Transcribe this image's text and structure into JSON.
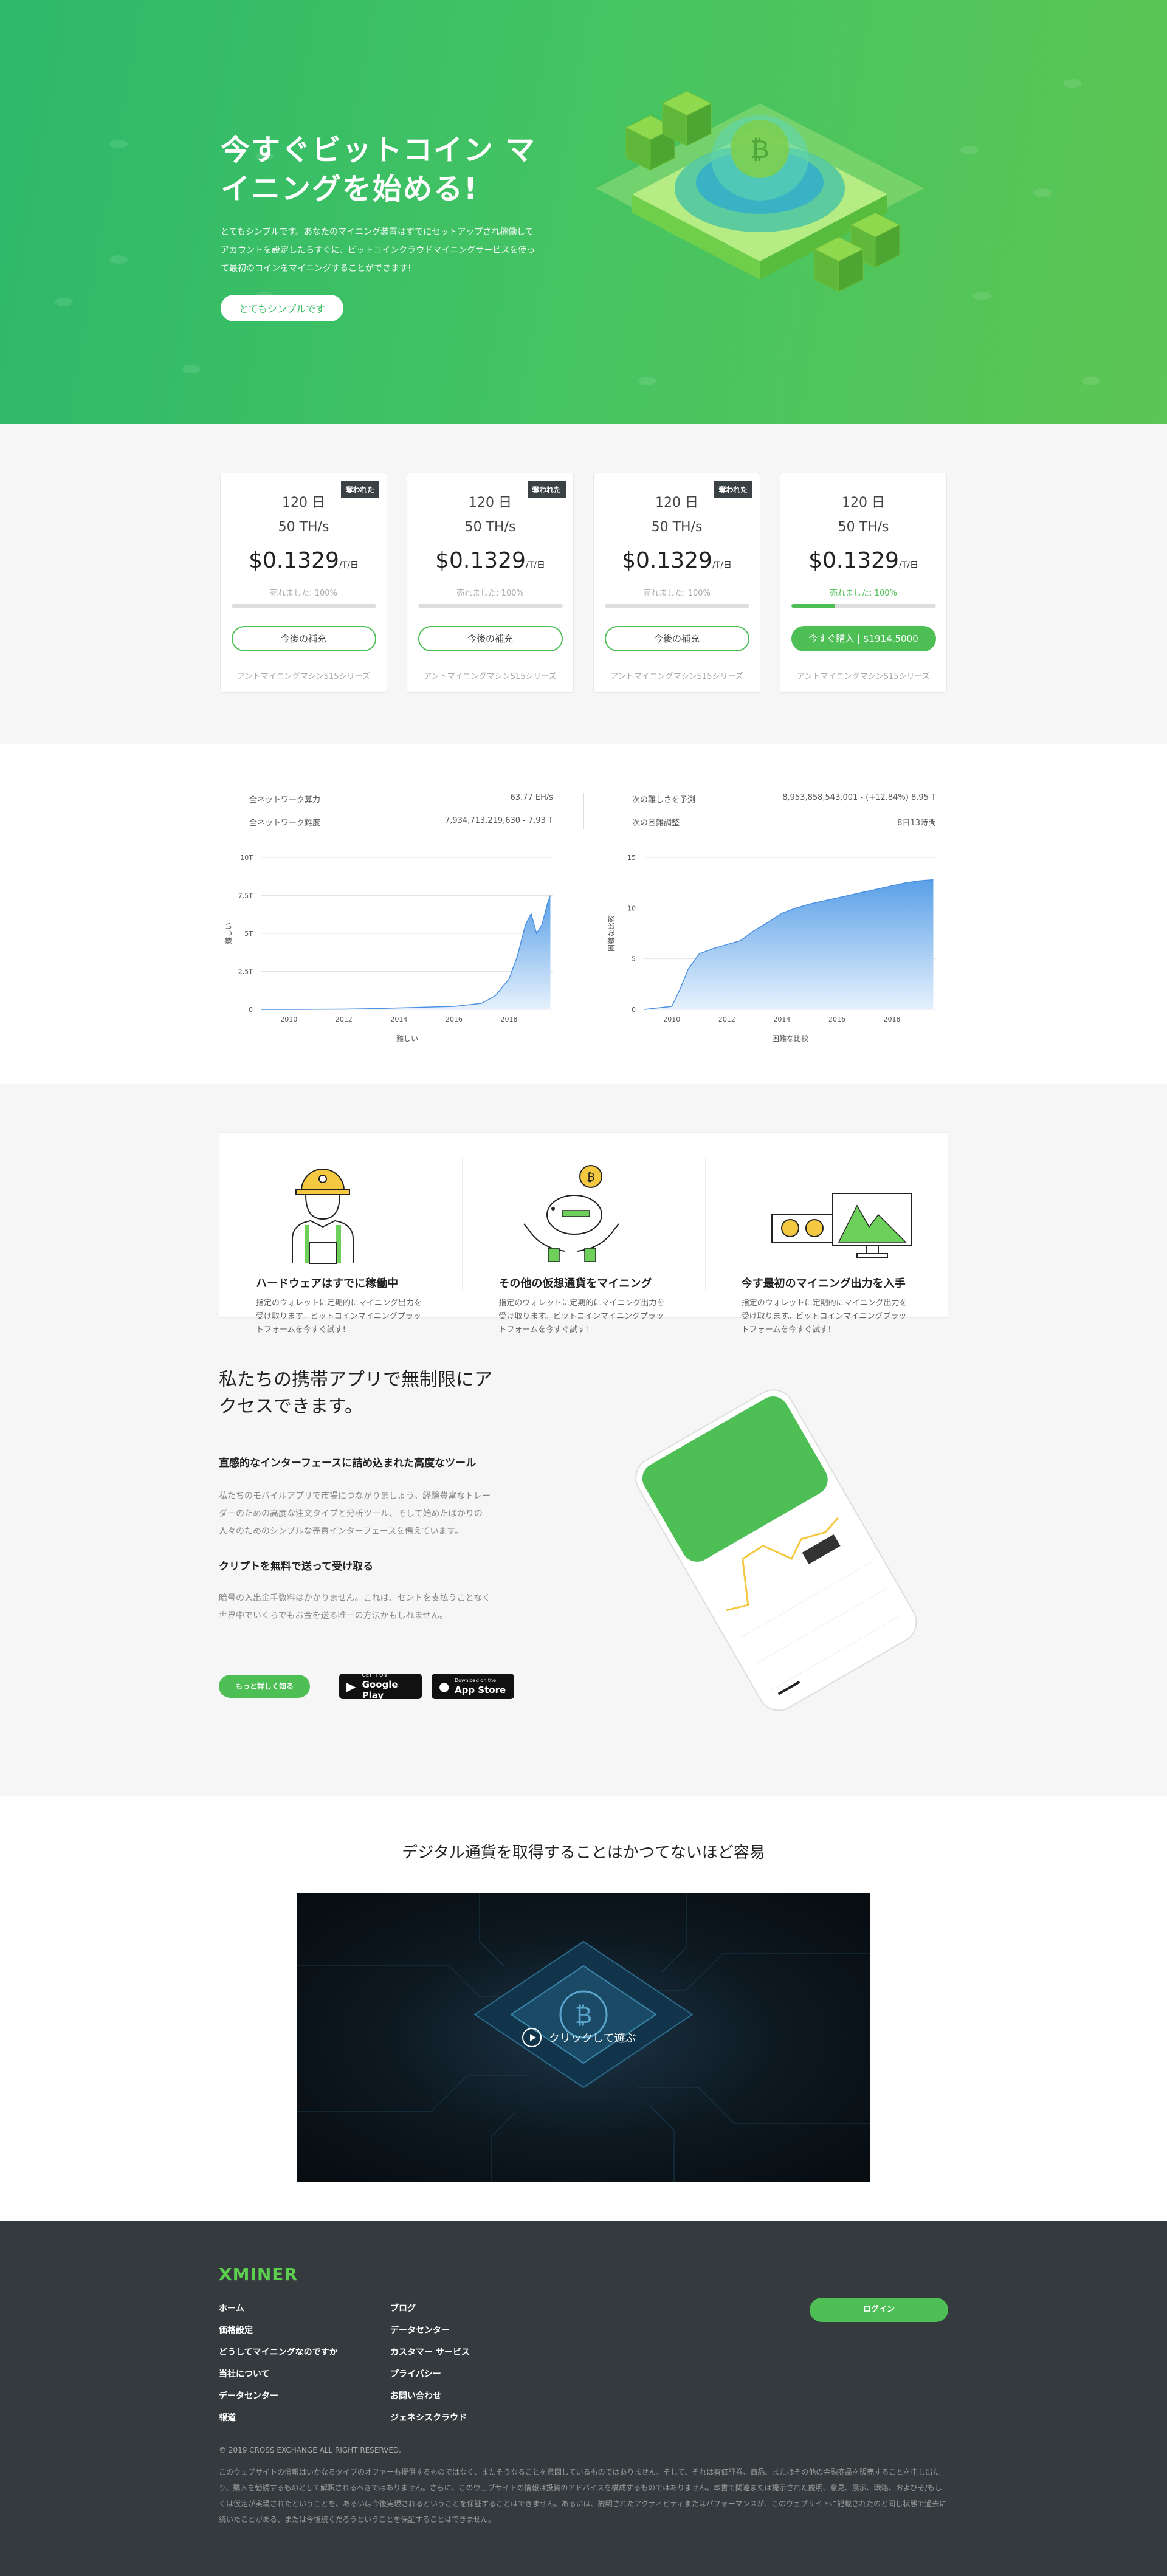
{
  "hero": {
    "title": "今すぐビットコイン マ\nイニングを始める!",
    "description": "とてもシンプルです。あなたのマイニング装置はすでにセットアップされ稼働して\nアカウントを設定したらすぐに、ビットコインクラウドマイニングサービスを使っ\nて最初のコインをマイニングすることができます!",
    "button": "とてもシンプルです"
  },
  "pricing": {
    "cards": [
      {
        "badge": "奪われた",
        "days": "120 日",
        "hash": "50 TH/s",
        "price": "$0.1329",
        "unit": "/T/日",
        "sold": "売れました: 100%",
        "progress": 1.0,
        "button": "今後の補充",
        "sub": "アントマイニングマシンS15シリーズ"
      },
      {
        "badge": "奪われた",
        "days": "120 日",
        "hash": "50 TH/s",
        "price": "$0.1329",
        "unit": "/T/日",
        "sold": "売れました: 100%",
        "progress": 1.0,
        "button": "今後の補充",
        "sub": "アントマイニングマシンS15シリーズ"
      },
      {
        "badge": "奪われた",
        "days": "120 日",
        "hash": "50 TH/s",
        "price": "$0.1329",
        "unit": "/T/日",
        "sold": "売れました: 100%",
        "progress": 1.0,
        "button": "今後の補充",
        "sub": "アントマイニングマシンS15シリーズ"
      },
      {
        "badge": "",
        "days": "120 日",
        "hash": "50 TH/s",
        "price": "$0.1329",
        "unit": "/T/日",
        "sold": "売れました: 100%",
        "progress": 0.3,
        "button": "今すぐ購入 | $1914.5000",
        "sub": "アントマイニングマシンS15シリーズ"
      }
    ]
  },
  "stats": {
    "left": {
      "rows": [
        {
          "label": "全ネットワーク算力",
          "value": "63.77 EH/s"
        },
        {
          "label": "全ネットワーク難度",
          "value": "7,934,713,219,630 - 7.93 T"
        }
      ]
    },
    "right": {
      "rows": [
        {
          "label": "次の難しさを予測",
          "value": "8,953,858,543,001 - (+12.84%) 8.95 T"
        },
        {
          "label": "次の困難調整",
          "value": "8日13時間"
        }
      ]
    }
  },
  "chart_data": [
    {
      "type": "area",
      "xlabel": "難しい",
      "ylabel": "難しい",
      "x": [
        2009,
        2010,
        2011,
        2012,
        2013,
        2014,
        2015,
        2016,
        2017,
        2017.5,
        2018,
        2018.3,
        2018.6,
        2018.8,
        2019,
        2019.2,
        2019.4,
        2019.5
      ],
      "y": [
        0,
        0,
        0.01,
        0.02,
        0.05,
        0.1,
        0.15,
        0.2,
        0.4,
        0.9,
        2.0,
        3.5,
        5.6,
        6.3,
        5.0,
        5.6,
        7.0,
        7.5
      ],
      "xticks": [
        "2010",
        "2012",
        "2014",
        "2016",
        "2018"
      ],
      "yticks": [
        "0",
        "2.5T",
        "5T",
        "7.5T",
        "10T"
      ],
      "ylim": [
        0,
        10
      ]
    },
    {
      "type": "area",
      "xlabel": "困難な比較",
      "ylabel": "困難な比較",
      "x": [
        2009,
        2010,
        2010.3,
        2010.6,
        2011,
        2011.5,
        2012,
        2012.5,
        2013,
        2013.5,
        2014,
        2014.5,
        2015,
        2015.5,
        2016,
        2016.5,
        2017,
        2017.5,
        2018,
        2018.5,
        2019,
        2019.5
      ],
      "y": [
        0,
        0.3,
        2.0,
        4.0,
        5.5,
        6.0,
        6.4,
        6.8,
        7.8,
        8.6,
        9.5,
        10.0,
        10.4,
        10.7,
        11.0,
        11.3,
        11.6,
        11.9,
        12.2,
        12.5,
        12.7,
        12.8
      ],
      "xticks": [
        "2010",
        "2012",
        "2014",
        "2016",
        "2018"
      ],
      "yticks": [
        "0",
        "5",
        "10",
        "15"
      ],
      "ylim": [
        0,
        15
      ]
    }
  ],
  "features": [
    {
      "title": "ハードウェアはすでに稼働中",
      "text": "指定のウォレットに定期的にマイニング出力を受け取ります。ビットコインマイニングプラットフォームを今すぐ試す!"
    },
    {
      "title": "その他の仮想通貨をマイニング",
      "text": "指定のウォレットに定期的にマイニング出力を受け取ります。ビットコインマイニングプラットフォームを今すぐ試す!"
    },
    {
      "title": "今す最初のマイニング出力を入手",
      "text": "指定のウォレットに定期的にマイニング出力を受け取ります。ビットコインマイニングプラットフォームを今すぐ試す!"
    }
  ],
  "app": {
    "title": "私たちの携帯アプリで無制限にア\nクセスできます。",
    "h1": "直感的なインターフェースに詰め込まれた高度なツール",
    "p1": "私たちのモバイルアプリで市場につながりましょう。経験豊富なトレーダーのための高度な注文タイプと分析ツール、そして始めたばかりの人々のためのシンプルな売買インターフェースを備えています。",
    "h2": "クリプトを無料で送って受け取る",
    "p2": "暗号の入出金手数料はかかりません。これは、セントを支払うことなく世界中でいくらでもお金を送る唯一の方法かもしれません。",
    "more": "もっと詳しく知る",
    "google_top": "GET IT ON",
    "google": "Google Play",
    "apple_top": "Download on the",
    "apple": "App Store"
  },
  "video": {
    "title": "デジタル通貨を取得することはかつてないほど容易",
    "play": "クリックして遊ぶ"
  },
  "footer": {
    "logo": "XMINER",
    "col1": [
      "ホーム",
      "価格設定",
      "どうしてマイニングなのですか",
      "当社について",
      "データセンター",
      "報道"
    ],
    "col2": [
      "ブログ",
      "データセンター",
      "カスタマー サービス",
      "プライバシー",
      "お問い合わせ",
      "ジェネシスクラウド"
    ],
    "login": "ログイン",
    "copyright": "© 2019 CROSS EXCHANGE ALL RIGHT RESERVED.",
    "disclaimer": "このウェブサイトの情報はいかなるタイプのオファーも提供するものではなく、またそうなることを意図しているものではありません。そして、それは有価証券、商品、またはその他の金融商品を販売することを申し出たり、購入を勧誘するものとして解釈されるべきではありません。さらに、このウェブサイトの情報は投資のアドバイスを構成するものではありません。本書で関連または提示された説明、意見、展示、戦略、およびそ/もしくは仮定が実現されたということを、あるいは今後実現されるということを保証することはできません。あるいは、説明されたアクティビティまたはパフォーマンスが、このウェブサイトに記載されたのと同じ状態で過去に続いたことがある、または今後続くだろうということを保証することはできません。"
  },
  "colors": {
    "accent": "#4dbf55",
    "hero_start": "#2db86a",
    "hero_end": "#5dc654",
    "footer_bg": "#343a3d",
    "logo": "#5ccf4f"
  }
}
